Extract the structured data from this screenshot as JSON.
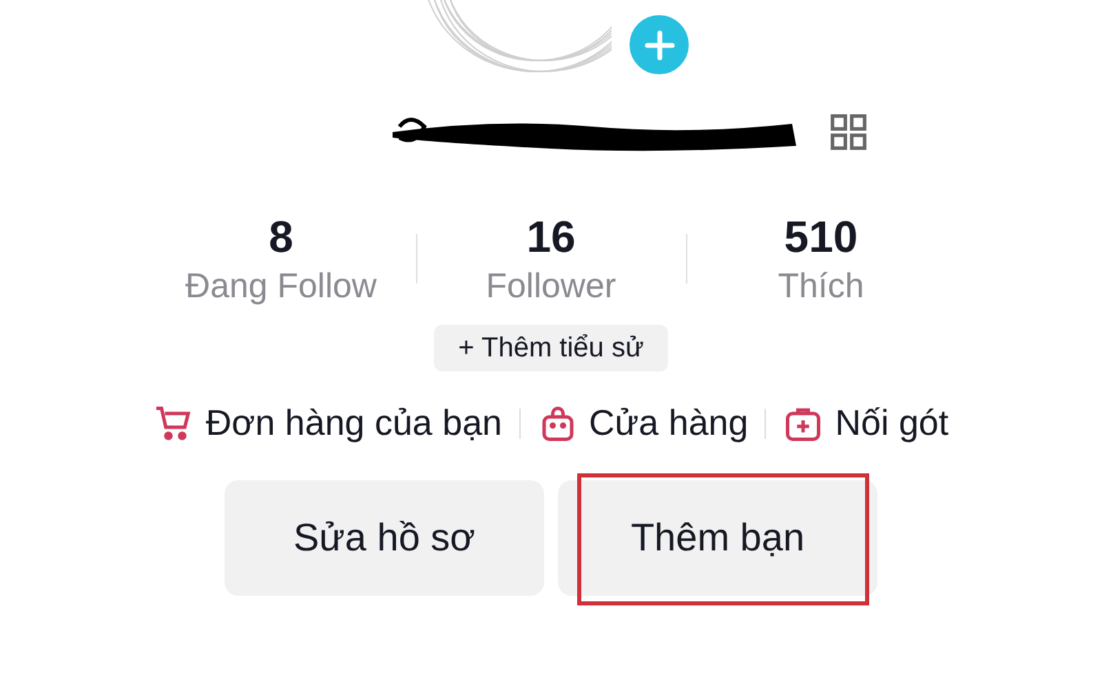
{
  "stats": [
    {
      "value": "8",
      "label": "Đang Follow"
    },
    {
      "value": "16",
      "label": "Follower"
    },
    {
      "value": "510",
      "label": "Thích"
    }
  ],
  "bio_button": "+ Thêm tiểu sử",
  "links": [
    {
      "kind": "cart",
      "label": "Đơn hàng của bạn"
    },
    {
      "kind": "bag",
      "label": "Cửa hàng"
    },
    {
      "kind": "plusbox",
      "label": "Nối gót"
    }
  ],
  "buttons": [
    {
      "label": "Sửa hồ sơ",
      "highlighted": false
    },
    {
      "label": "Thêm bạn",
      "highlighted": true
    }
  ]
}
